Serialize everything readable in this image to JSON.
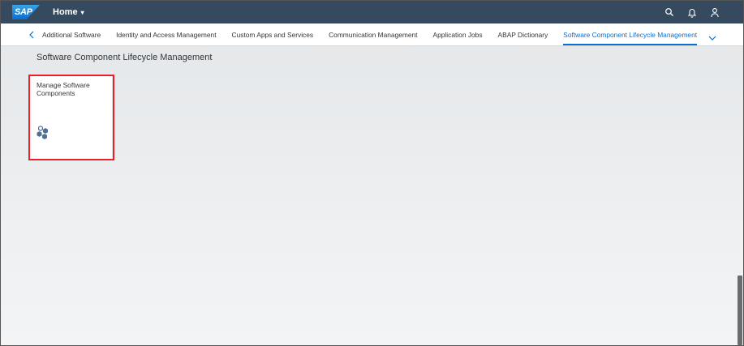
{
  "shell": {
    "logo_text": "SAP",
    "home_label": "Home",
    "caret": "▾",
    "icons": [
      "search-icon",
      "bell-icon",
      "user-icon"
    ]
  },
  "tabs": {
    "items": [
      {
        "label": "Additional Software",
        "selected": false
      },
      {
        "label": "Identity and Access Management",
        "selected": false
      },
      {
        "label": "Custom Apps and Services",
        "selected": false
      },
      {
        "label": "Communication Management",
        "selected": false
      },
      {
        "label": "Application Jobs",
        "selected": false
      },
      {
        "label": "ABAP Dictionary",
        "selected": false
      },
      {
        "label": "Software Component Lifecycle Management",
        "selected": true
      }
    ],
    "left_icon": "chevron-left-icon",
    "right_icon": "chevron-down-icon"
  },
  "main": {
    "section_title": "Software Component Lifecycle Management",
    "tile": {
      "title": "Manage Software Components",
      "icon": "software-components-icon"
    }
  },
  "colors": {
    "shell_bg": "#354a5f",
    "accent": "#0a6ed1",
    "highlight": "#e8202a",
    "icon": "#4e6f96"
  }
}
